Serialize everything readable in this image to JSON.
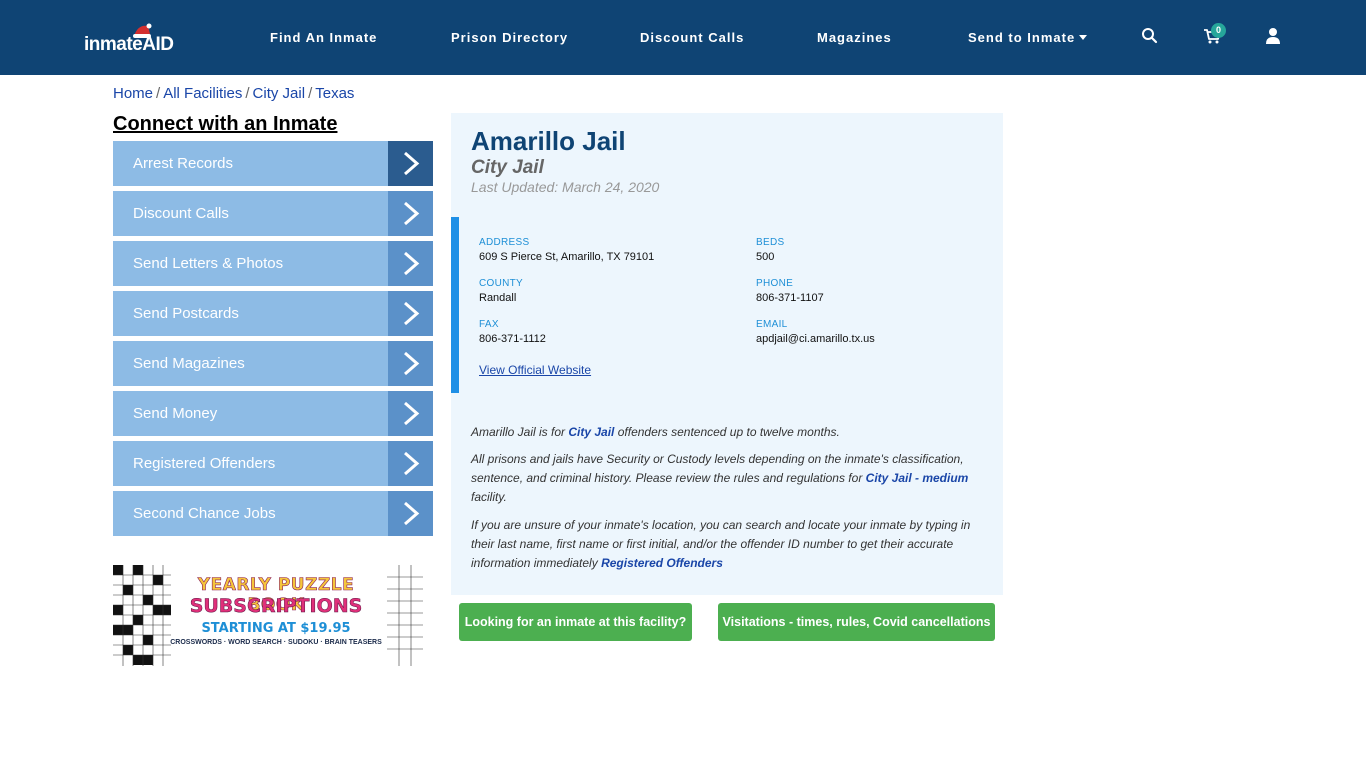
{
  "header": {
    "logo_text": "inmateAID",
    "nav": [
      {
        "label": "Find An Inmate"
      },
      {
        "label": "Prison Directory"
      },
      {
        "label": "Discount Calls"
      },
      {
        "label": "Magazines"
      },
      {
        "label": "Send to Inmate"
      }
    ],
    "cart_count": "0",
    "icons": [
      "search-icon",
      "cart-icon",
      "user-icon"
    ]
  },
  "breadcrumb": [
    "Home",
    "All Facilities",
    "City Jail",
    "Texas"
  ],
  "sidebar": {
    "title": "Connect with an Inmate",
    "items": [
      {
        "label": "Arrest Records"
      },
      {
        "label": "Discount Calls"
      },
      {
        "label": "Send Letters & Photos"
      },
      {
        "label": "Send Postcards"
      },
      {
        "label": "Send Magazines"
      },
      {
        "label": "Send Money"
      },
      {
        "label": "Registered Offenders"
      },
      {
        "label": "Second Chance Jobs"
      }
    ],
    "banner": {
      "line1": "YEARLY PUZZLE BOOK",
      "line2": "SUBSCRIPTIONS",
      "line3": "STARTING AT $19.95",
      "line4": "CROSSWORDS · WORD SEARCH · SUDOKU · BRAIN TEASERS"
    }
  },
  "facility": {
    "name": "Amarillo Jail",
    "type": "City Jail",
    "last_updated": "Last Updated: March 24, 2020",
    "address_label": "ADDRESS",
    "address": "609 S Pierce St, Amarillo, TX 79101",
    "beds_label": "BEDS",
    "beds": "500",
    "county_label": "COUNTY",
    "county": "Randall",
    "phone_label": "PHONE",
    "phone": "806-371-1107",
    "fax_label": "FAX",
    "fax": "806-371-1112",
    "email_label": "EMAIL",
    "email": "apdjail@ci.amarillo.tx.us",
    "website_link": "View Official Website"
  },
  "description": {
    "p1_pre": "Amarillo Jail is for ",
    "p1_link": "City Jail",
    "p1_post": " offenders sentenced up to twelve months.",
    "p2_pre": "All prisons and jails have Security or Custody levels depending on the inmate's classification, sentence, and criminal history. Please review the rules and regulations for ",
    "p2_link": "City Jail - medium",
    "p2_post": " facility.",
    "p3_pre": "If you are unsure of your inmate's location, you can search and locate your inmate by typing in their last name, first name or first initial, and/or the offender ID number to get their accurate information immediately ",
    "p3_link": "Registered Offenders"
  },
  "actions": {
    "find_inmate": "Looking for an inmate at this facility?",
    "visitations": "Visitations - times, rules, Covid cancellations"
  },
  "colors": {
    "header_bg": "#0f4474",
    "sidebar_btn": "#8dbbe5",
    "sidebar_arrow": "#5b91c9",
    "card_bg": "#edf6fd",
    "accent_blue": "#1e8fe6",
    "green_btn": "#4caf50"
  }
}
